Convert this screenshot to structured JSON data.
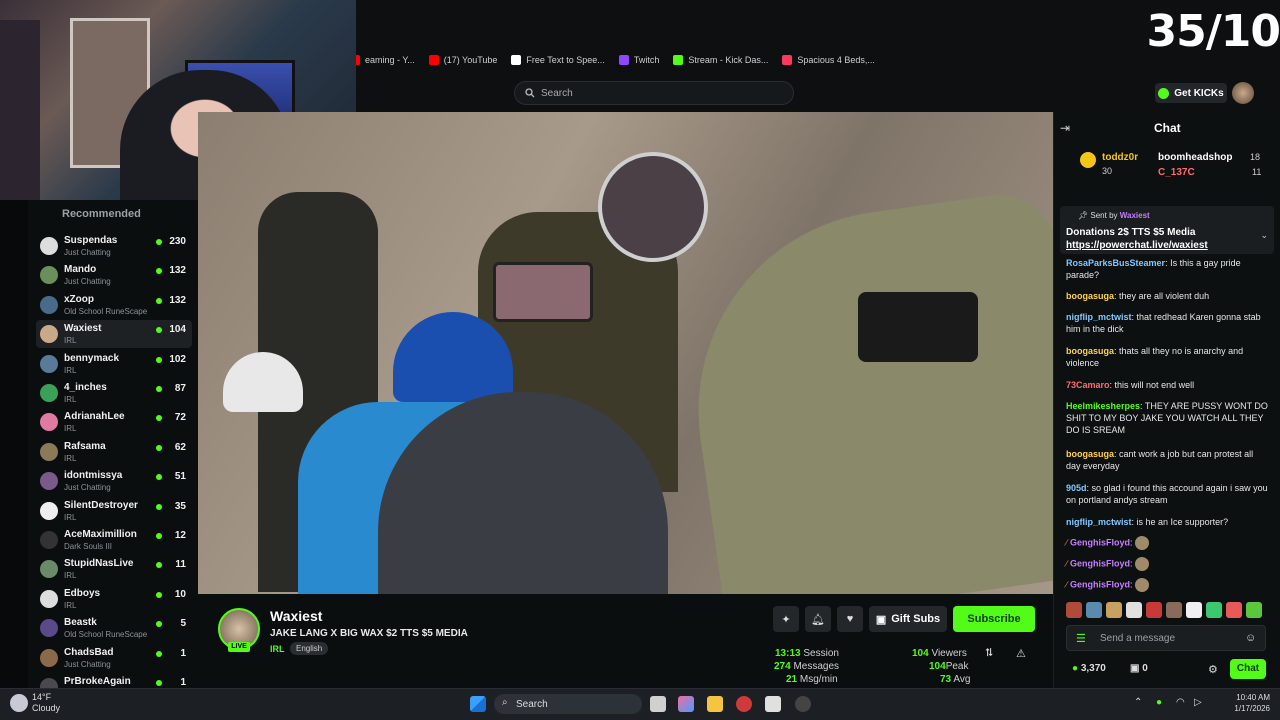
{
  "overlay": {
    "counter": "35/10"
  },
  "bookmarks": [
    {
      "label": "eaming - Y...",
      "color": "#ff0000"
    },
    {
      "label": "(17) YouTube",
      "color": "#ff0000"
    },
    {
      "label": "Free Text to Spee...",
      "color": "#ffffff"
    },
    {
      "label": "Twitch",
      "color": "#9146ff"
    },
    {
      "label": "Stream - Kick Das...",
      "color": "#53fc18"
    },
    {
      "label": "Spacious 4 Beds,...",
      "color": "#ff385c"
    }
  ],
  "header": {
    "search_placeholder": "Search",
    "get_kicks": "Get KICKs"
  },
  "sidebar": {
    "title": "Recommended",
    "channels": [
      {
        "name": "Suspendas",
        "category": "Just Chatting",
        "viewers": "230",
        "color": "#ddd"
      },
      {
        "name": "Mando",
        "category": "Just Chatting",
        "viewers": "132",
        "color": "#6a8f5a"
      },
      {
        "name": "xZoop",
        "category": "Old School RuneScape",
        "viewers": "132",
        "color": "#4a6a8a"
      },
      {
        "name": "Waxiest",
        "category": "IRL",
        "viewers": "104",
        "color": "#c9a98a"
      },
      {
        "name": "bennymack",
        "category": "IRL",
        "viewers": "102",
        "color": "#5a7a9a"
      },
      {
        "name": "4_inches",
        "category": "IRL",
        "viewers": "87",
        "color": "#3aa05a"
      },
      {
        "name": "AdrianahLee",
        "category": "IRL",
        "viewers": "72",
        "color": "#e07aa0"
      },
      {
        "name": "Rafsama",
        "category": "IRL",
        "viewers": "62",
        "color": "#8a7a5a"
      },
      {
        "name": "idontmissya",
        "category": "Just Chatting",
        "viewers": "51",
        "color": "#7a5a8a"
      },
      {
        "name": "SilentDestroyer",
        "category": "IRL",
        "viewers": "35",
        "color": "#eeeeee"
      },
      {
        "name": "AceMaximillion",
        "category": "Dark Souls III",
        "viewers": "12",
        "color": "#333333"
      },
      {
        "name": "StupidNasLive",
        "category": "IRL",
        "viewers": "11",
        "color": "#6a8a6a"
      },
      {
        "name": "Edboys",
        "category": "IRL",
        "viewers": "10",
        "color": "#dddddd"
      },
      {
        "name": "Beastk",
        "category": "Old School RuneScape",
        "viewers": "5",
        "color": "#5a4a8a"
      },
      {
        "name": "ChadsBad",
        "category": "Just Chatting",
        "viewers": "1",
        "color": "#8a6a4a"
      },
      {
        "name": "PrBrokeAgain",
        "category": "",
        "viewers": "1",
        "color": "#4a4a4a"
      }
    ]
  },
  "stream": {
    "name": "Waxiest",
    "title": "JAKE LANG X BIG WAX $2 TTS $5 MEDIA",
    "category": "IRL",
    "language": "English",
    "live_badge": "LIVE",
    "gift_subs": "Gift Subs",
    "subscribe": "Subscribe",
    "stats": {
      "session": "13:13",
      "session_label": "Session",
      "messages": "274",
      "messages_label": "Messages",
      "msg_per_min": "21",
      "msg_per_min_label": "Msg/min",
      "viewers": "104",
      "viewers_label": "Viewers",
      "peak": "104",
      "peak_label": "Peak",
      "avg": "73",
      "avg_label": "Avg"
    }
  },
  "chat": {
    "title": "Chat",
    "gifters": [
      {
        "name": "toddz0r",
        "count": "30"
      },
      {
        "name": "boomheadshop",
        "count": "18"
      },
      {
        "name": "C_137C",
        "count": "11"
      }
    ],
    "pinned": {
      "sent_by": "Sent by",
      "user": "Waxiest",
      "text": "Donations 2$ TTS $5 Media",
      "link": "https://powerchat.live/waxiest"
    },
    "messages": [
      {
        "user": "RosaParksBusSteamer",
        "text": "Is this a gay pride parade?",
        "color": "#7fc8ff"
      },
      {
        "user": "boogasuga",
        "text": "they are all violent duh",
        "color": "#ffd24a"
      },
      {
        "user": "nigflip_mctwist",
        "text": "that redhead Karen gonna stab him in the dick",
        "color": "#7fc8ff"
      },
      {
        "user": "boogasuga",
        "text": "thats all they no is anarchy and violence",
        "color": "#ffd24a"
      },
      {
        "user": "73Camaro",
        "text": "this will not end well",
        "color": "#ff6b6b"
      },
      {
        "user": "Heelmikesherpes",
        "text": "THEY ARE PUSSY WONT DO SHIT TO MY BOY JAKE YOU WATCH ALL THEY DO IS SREAM",
        "color": "#53fc18"
      },
      {
        "user": "boogasuga",
        "text": "cant work a job but can protest all day everyday",
        "color": "#ffd24a"
      },
      {
        "user": "905d",
        "text": "so glad i found this accound again i saw you on portland andys stream",
        "color": "#7fc8ff"
      },
      {
        "user": "nigflip_mctwist",
        "text": "is he an Ice supporter?",
        "color": "#7fc8ff"
      },
      {
        "user": "GenghisFloyd",
        "text": "",
        "color": "#c77dff"
      },
      {
        "user": "GenghisFloyd",
        "text": "",
        "color": "#c77dff"
      },
      {
        "user": "GenghisFloyd",
        "text": "",
        "color": "#c77dff"
      }
    ],
    "input_placeholder": "Send a message",
    "kicks_balance": "3,370",
    "other_balance": "0",
    "send_label": "Chat"
  },
  "taskbar": {
    "weather_temp": "14°F",
    "weather_desc": "Cloudy",
    "search": "Search",
    "time": "10:40 AM",
    "date": "1/17/2026"
  }
}
